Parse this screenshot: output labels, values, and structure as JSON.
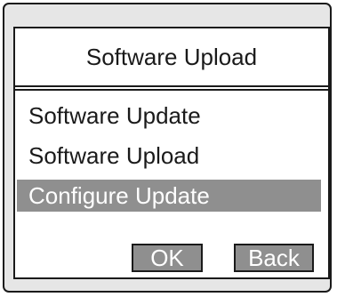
{
  "dialog": {
    "title": "Software Upload"
  },
  "menu": {
    "items": [
      {
        "label": "Software Update",
        "selected": false
      },
      {
        "label": "Software Upload",
        "selected": false
      },
      {
        "label": "Configure Update",
        "selected": true
      }
    ]
  },
  "buttons": {
    "ok_label": "OK",
    "back_label": "Back"
  },
  "colors": {
    "highlight": "#8f8f8f",
    "border": "#1a1a1a",
    "device_bg": "#e6e6e6"
  }
}
